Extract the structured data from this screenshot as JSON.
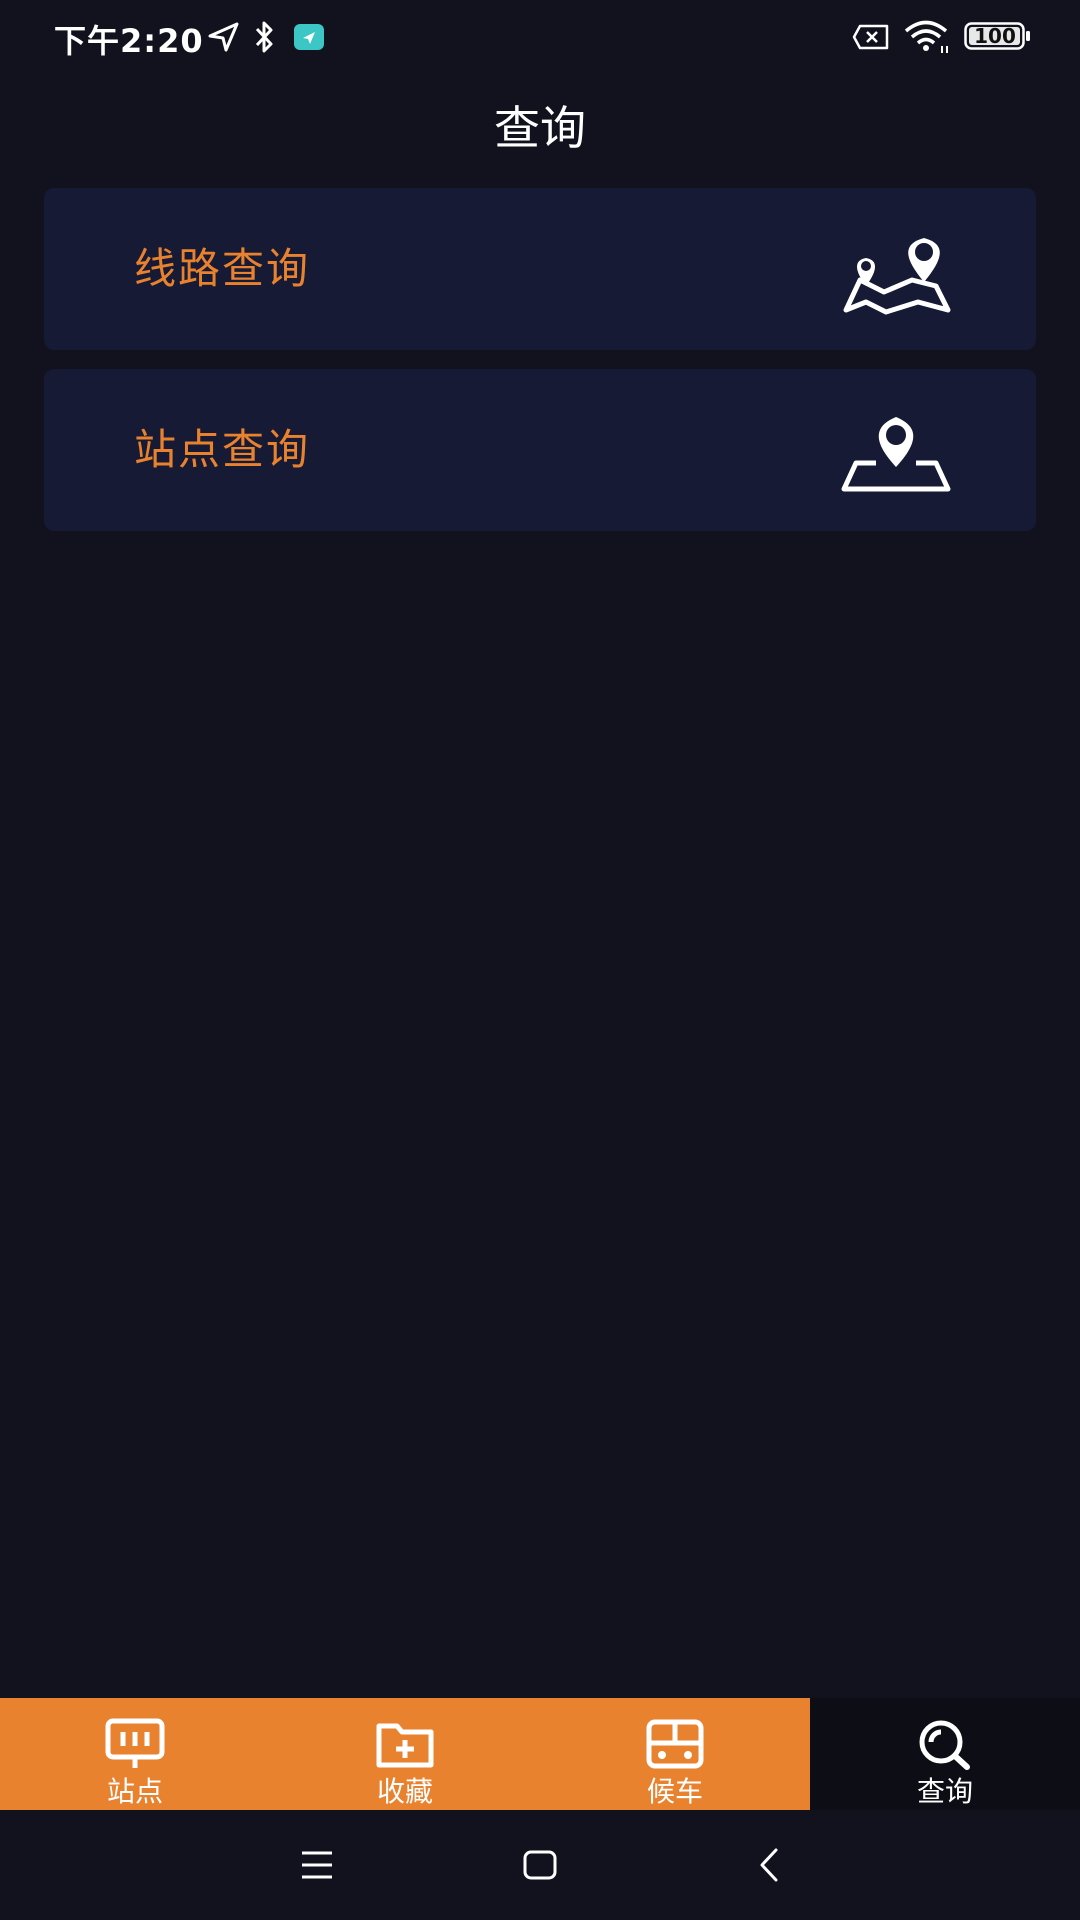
{
  "status_bar": {
    "time": "下午2:20",
    "battery": "100"
  },
  "header": {
    "title": "查询"
  },
  "cards": [
    {
      "label": "线路查询",
      "icon": "route-map-icon"
    },
    {
      "label": "站点查询",
      "icon": "station-pin-icon"
    }
  ],
  "bottom_nav": {
    "items": [
      {
        "label": "站点",
        "icon": "station-sign-icon",
        "active": false
      },
      {
        "label": "收藏",
        "icon": "favorite-folder-icon",
        "active": false
      },
      {
        "label": "候车",
        "icon": "bus-icon",
        "active": false
      },
      {
        "label": "查询",
        "icon": "search-icon",
        "active": true
      }
    ]
  },
  "colors": {
    "background": "#12121e",
    "card": "#161a34",
    "accent": "#e8822f",
    "active_tab": "#0d0d16"
  }
}
